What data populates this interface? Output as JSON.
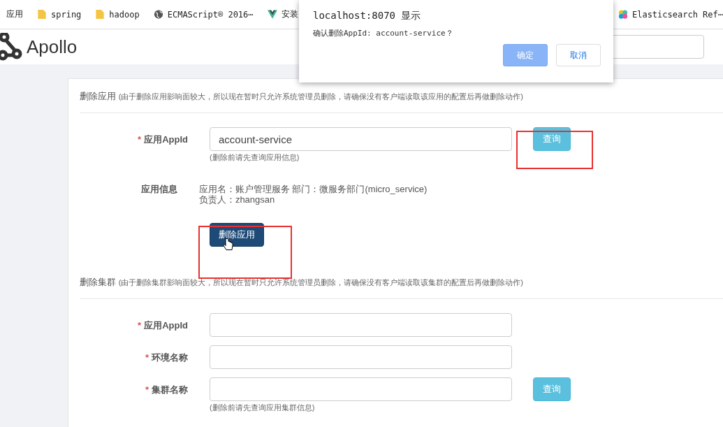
{
  "bookmarks": [
    {
      "label": "应用",
      "kind": "plain"
    },
    {
      "label": "spring",
      "kind": "folder"
    },
    {
      "label": "hadoop",
      "kind": "folder"
    },
    {
      "label": "ECMAScript® 2016⋯",
      "kind": "globe"
    },
    {
      "label": "安装",
      "kind": "vue"
    },
    {
      "label": "Elasticsearch Ref⋯",
      "kind": "elastic"
    }
  ],
  "header": {
    "logo": "Apollo"
  },
  "sections": [
    {
      "title": "删除应用",
      "note": "(由于删除应用影响面较大，所以现在暂时只允许系统管理员删除，请确保没有客户端读取该应用的配置后再做删除动作)",
      "rows": [
        {
          "kind": "input",
          "mark": "*",
          "label": "应用AppId",
          "value": "account-service",
          "button": "查询",
          "hint": "(删除前请先查询应用信息)"
        },
        {
          "kind": "info",
          "label": "应用信息",
          "text": "应用名：账户管理服务 部门：微服务部门(micro_service) 负责人：zhangsan"
        }
      ],
      "action": "删除应用"
    },
    {
      "title": "删除集群",
      "note": "(由于删除集群影响面较大，所以现在暂时只允许系统管理员删除，请确保没有客户端读取该集群的配置后再做删除动作)",
      "rows": [
        {
          "kind": "input",
          "mark": "*",
          "label": "应用AppId",
          "value": ""
        },
        {
          "kind": "input",
          "mark": "*",
          "label": "环境名称",
          "value": ""
        },
        {
          "kind": "input",
          "mark": "*",
          "label": "集群名称",
          "value": "",
          "button": "查询",
          "hint": "(删除前请先查询应用集群信息)"
        }
      ]
    }
  ],
  "dialog": {
    "title": "localhost:8070 显示",
    "message": "确认删除AppId: account-service？",
    "buttons": [
      {
        "label": "确定",
        "primary": true
      },
      {
        "label": "取消",
        "primary": false
      }
    ]
  }
}
